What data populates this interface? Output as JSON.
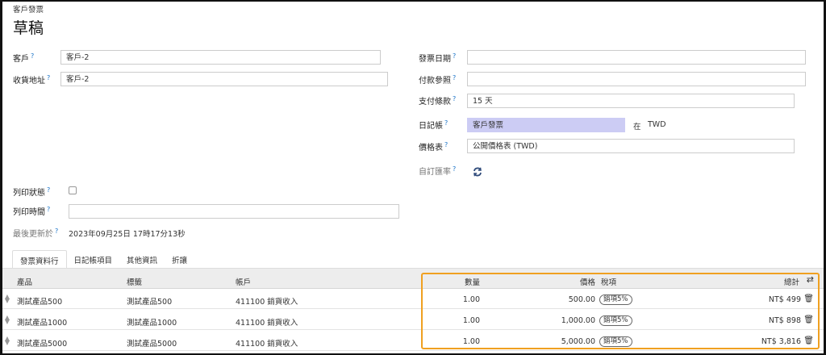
{
  "breadcrumb": "客戶發票",
  "title": "草稿",
  "help_mark": "?",
  "fields": {
    "customer_label": "客戶",
    "customer_value": "客戶-2",
    "delivery_address_label": "收貨地址",
    "delivery_address_value": "客戶-2",
    "invoice_date_label": "發票日期",
    "invoice_date_value": "",
    "payment_reference_label": "付款參照",
    "payment_reference_value": "",
    "payment_terms_label": "支付條款",
    "payment_terms_value": "15 天",
    "journal_label": "日記帳",
    "journal_value": "客戶發票",
    "journal_in_label": "在",
    "journal_currency": "TWD",
    "pricelist_label": "價格表",
    "pricelist_value": "公開價格表 (TWD)",
    "custom_rate_label": "自訂匯率",
    "print_status_label": "列印狀態",
    "print_time_label": "列印時間",
    "print_time_value": "",
    "last_updated_label": "最後更新於",
    "last_updated_value": "2023年09月25日 17時17分13秒"
  },
  "tabs": [
    {
      "label": "發票資料行",
      "active": true
    },
    {
      "label": "日記帳項目",
      "active": false
    },
    {
      "label": "其他資訊",
      "active": false
    },
    {
      "label": "折讓",
      "active": false
    }
  ],
  "table": {
    "headers": {
      "product": "產品",
      "label": "標籤",
      "account": "帳戶",
      "quantity": "數量",
      "price": "價格",
      "taxes": "稅項",
      "total": "總計"
    },
    "rows": [
      {
        "product": "測試產品500",
        "label": "測試產品500",
        "account": "411100 銷貨收入",
        "quantity": "1.00",
        "price": "500.00",
        "tax": "銷項5%",
        "total": "NT$ 499"
      },
      {
        "product": "測試產品1000",
        "label": "測試產品1000",
        "account": "411100 銷貨收入",
        "quantity": "1.00",
        "price": "1,000.00",
        "tax": "銷項5%",
        "total": "NT$ 898"
      },
      {
        "product": "測試產品5000",
        "label": "測試產品5000",
        "account": "411100 銷貨收入",
        "quantity": "1.00",
        "price": "5,000.00",
        "tax": "銷項5%",
        "total": "NT$ 3,816"
      }
    ]
  },
  "colors": {
    "highlight": "#f0a020",
    "journal_bg": "#ccccf4",
    "help_mark": "#1a73c8"
  }
}
